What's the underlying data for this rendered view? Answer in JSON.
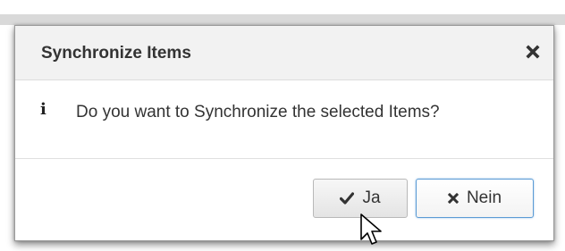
{
  "dialog": {
    "title": "Synchronize Items",
    "close_icon": "close-icon",
    "info_icon_glyph": "i",
    "message": "Do you want to Synchronize the selected Items?",
    "buttons": {
      "ja": {
        "label": "Ja",
        "icon": "check-icon"
      },
      "nein": {
        "label": "Nein",
        "icon": "close-icon"
      }
    }
  },
  "colors": {
    "header_bg": "#f2f2f2",
    "focus_border": "#5b9bd5",
    "text": "#333333"
  }
}
